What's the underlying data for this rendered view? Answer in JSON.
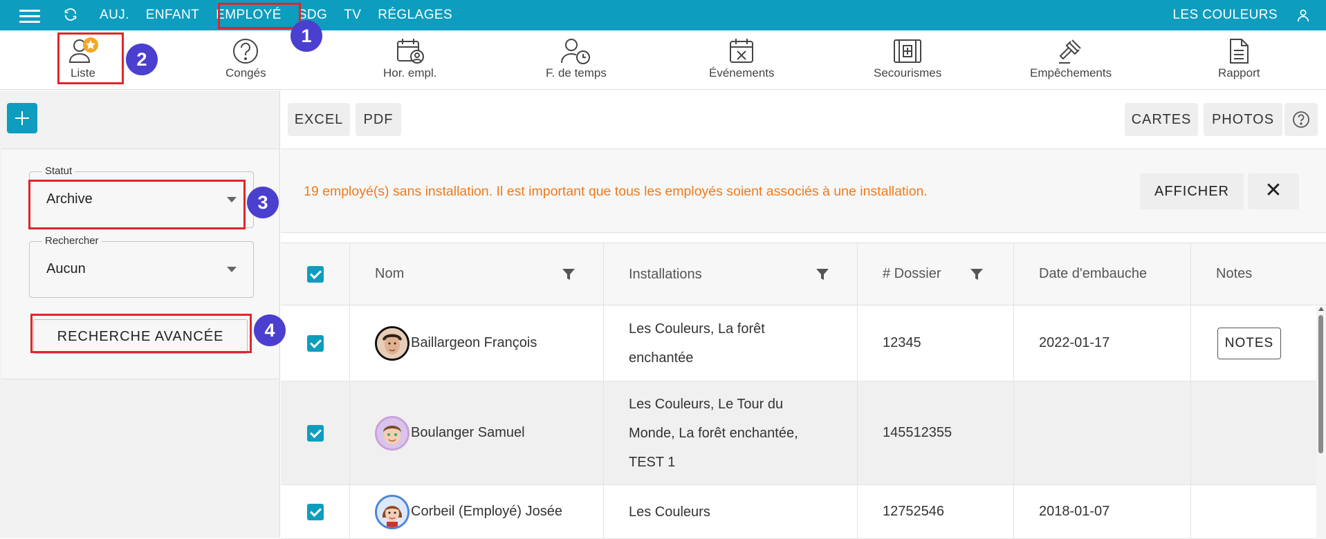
{
  "topbar": {
    "nav": [
      "AUJ.",
      "ENFANT",
      "EMPLOYÉ",
      "SDG",
      "TV",
      "RÉGLAGES"
    ],
    "active": "EMPLOYÉ",
    "site_name": "LES COULEURS",
    "accent_color": "#0d9dbf"
  },
  "toolbar": {
    "items": [
      {
        "label": "Liste",
        "icon": "user-star-icon"
      },
      {
        "label": "Congés",
        "icon": "question-circle-icon"
      },
      {
        "label": "Hor. empl.",
        "icon": "calendar-user-icon"
      },
      {
        "label": "F. de temps",
        "icon": "user-clock-icon"
      },
      {
        "label": "Événements",
        "icon": "calendar-x-icon"
      },
      {
        "label": "Secourismes",
        "icon": "first-aid-icon"
      },
      {
        "label": "Empêchements",
        "icon": "gavel-icon"
      },
      {
        "label": "Rapport",
        "icon": "document-icon"
      }
    ]
  },
  "sidebar": {
    "statut": {
      "legend": "Statut",
      "value": "Archive"
    },
    "rechercher": {
      "legend": "Rechercher",
      "value": "Aucun"
    },
    "advanced_label": "RECHERCHE AVANCÉE"
  },
  "actions": {
    "excel": "EXCEL",
    "pdf": "PDF",
    "cartes": "CARTES",
    "photos": "PHOTOS"
  },
  "alert": {
    "message": "19 employé(s) sans installation. Il est important que tous les employés soient associés à une installation.",
    "show_label": "AFFICHER",
    "close_label": "✕",
    "color": "#ef7a1a"
  },
  "table": {
    "columns": [
      "Nom",
      "Installations",
      "# Dossier",
      "Date d'embauche",
      "Notes"
    ],
    "rows": [
      {
        "name": "Baillargeon François",
        "installations": "Les Couleurs, La forêt enchantée",
        "dossier": "12345",
        "date": "2022-01-17",
        "notes": "NOTES"
      },
      {
        "name": "Boulanger Samuel",
        "installations": "Les Couleurs, Le Tour du Monde, La forêt enchantée, TEST 1",
        "dossier": "145512355",
        "date": "",
        "notes": ""
      },
      {
        "name": "Corbeil (Employé) Josée",
        "installations": "Les Couleurs",
        "dossier": "12752546",
        "date": "2018-01-07",
        "notes": ""
      }
    ]
  },
  "annotations": [
    "1",
    "2",
    "3",
    "4"
  ]
}
